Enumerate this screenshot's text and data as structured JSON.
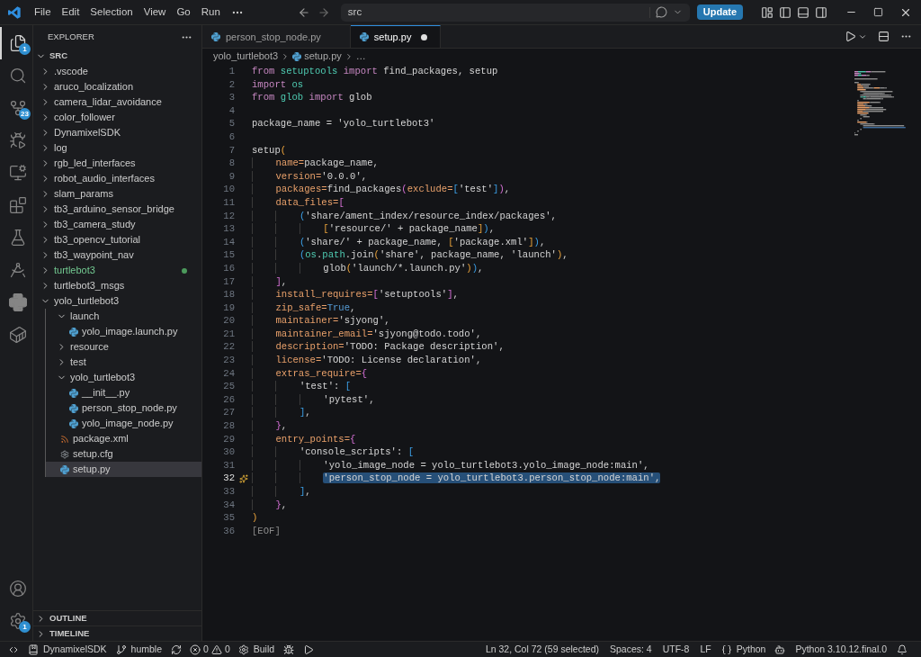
{
  "title_bar": {
    "menus": [
      "File",
      "Edit",
      "Selection",
      "View",
      "Go",
      "Run"
    ],
    "search": {
      "value": "src"
    },
    "update_button": "Update"
  },
  "activity_bar": {
    "top": [
      {
        "kind": "explorer",
        "selected": true,
        "badge": "1"
      },
      {
        "kind": "search",
        "selected": false
      },
      {
        "kind": "source-control",
        "selected": false,
        "badge": "23"
      },
      {
        "kind": "run-debug",
        "selected": false
      },
      {
        "kind": "remote",
        "selected": false
      },
      {
        "kind": "extensions",
        "selected": false
      },
      {
        "kind": "testing",
        "selected": false
      },
      {
        "kind": "compass",
        "selected": false
      },
      {
        "kind": "python",
        "selected": false
      },
      {
        "kind": "containers",
        "selected": false
      }
    ],
    "bottom": [
      {
        "kind": "account",
        "selected": false
      },
      {
        "kind": "settings",
        "selected": false,
        "badge": "1"
      }
    ]
  },
  "sidebar": {
    "title": "EXPLORER",
    "root": {
      "label": "SRC",
      "expanded": true
    },
    "tree": [
      {
        "label": ".vscode",
        "kind": "folder",
        "expanded": false,
        "selected": false,
        "git_changed": false
      },
      {
        "label": "aruco_localization",
        "kind": "folder",
        "expanded": false,
        "selected": false,
        "git_changed": false
      },
      {
        "label": "camera_lidar_avoidance",
        "kind": "folder",
        "expanded": false,
        "selected": false,
        "git_changed": false
      },
      {
        "label": "color_follower",
        "kind": "folder",
        "expanded": false,
        "selected": false,
        "git_changed": false
      },
      {
        "label": "DynamixelSDK",
        "kind": "folder",
        "expanded": false,
        "selected": false,
        "git_changed": false
      },
      {
        "label": "log",
        "kind": "folder",
        "expanded": false,
        "selected": false,
        "git_changed": false
      },
      {
        "label": "rgb_led_interfaces",
        "kind": "folder",
        "expanded": false,
        "selected": false,
        "git_changed": false
      },
      {
        "label": "robot_audio_interfaces",
        "kind": "folder",
        "expanded": false,
        "selected": false,
        "git_changed": false
      },
      {
        "label": "slam_params",
        "kind": "folder",
        "expanded": false,
        "selected": false,
        "git_changed": false
      },
      {
        "label": "tb3_arduino_sensor_bridge",
        "kind": "folder",
        "expanded": false,
        "selected": false,
        "git_changed": false
      },
      {
        "label": "tb3_camera_study",
        "kind": "folder",
        "expanded": false,
        "selected": false,
        "git_changed": false
      },
      {
        "label": "tb3_opencv_tutorial",
        "kind": "folder",
        "expanded": false,
        "selected": false,
        "git_changed": false
      },
      {
        "label": "tb3_waypoint_nav",
        "kind": "folder",
        "expanded": false,
        "selected": false,
        "git_changed": false
      },
      {
        "label": "turtlebot3",
        "kind": "folder",
        "expanded": false,
        "selected": false,
        "git_changed": true
      },
      {
        "label": "turtlebot3_msgs",
        "kind": "folder",
        "expanded": false,
        "selected": false,
        "git_changed": false
      },
      {
        "label": "yolo_turtlebot3",
        "kind": "folder",
        "expanded": true,
        "selected": false,
        "git_changed": false,
        "children": [
          {
            "label": "launch",
            "kind": "folder",
            "expanded": true,
            "selected": false,
            "git_changed": false,
            "children": [
              {
                "label": "yolo_image.launch.py",
                "kind": "python",
                "selected": false,
                "git_changed": false
              }
            ]
          },
          {
            "label": "resource",
            "kind": "folder",
            "expanded": false,
            "selected": false,
            "git_changed": false
          },
          {
            "label": "test",
            "kind": "folder",
            "expanded": false,
            "selected": false,
            "git_changed": false
          },
          {
            "label": "yolo_turtlebot3",
            "kind": "folder",
            "expanded": true,
            "selected": false,
            "git_changed": false,
            "children": [
              {
                "label": "__init__.py",
                "kind": "python",
                "selected": false,
                "git_changed": false
              },
              {
                "label": "person_stop_node.py",
                "kind": "python",
                "selected": false,
                "git_changed": false
              },
              {
                "label": "yolo_image_node.py",
                "kind": "python",
                "selected": false,
                "git_changed": false
              }
            ]
          },
          {
            "label": "package.xml",
            "kind": "xml",
            "selected": false,
            "git_changed": false
          },
          {
            "label": "setup.cfg",
            "kind": "config",
            "selected": false,
            "git_changed": false
          },
          {
            "label": "setup.py",
            "kind": "python",
            "selected": true,
            "git_changed": false
          }
        ]
      }
    ],
    "panels": [
      {
        "label": "OUTLINE",
        "expanded": false
      },
      {
        "label": "TIMELINE",
        "expanded": false
      }
    ]
  },
  "editor": {
    "tabs": [
      {
        "label": "person_stop_node.py",
        "selected": false,
        "dirty": false
      },
      {
        "label": "setup.py",
        "selected": true,
        "dirty": true
      }
    ],
    "breadcrumb": [
      "yolo_turtlebot3",
      "setup.py",
      "…"
    ],
    "lines": [
      {
        "number": "1",
        "current": false,
        "tokens": [
          {
            "kind": "kw",
            "text": "from "
          },
          {
            "kind": "mod",
            "text": "setuptools "
          },
          {
            "kind": "kw",
            "text": "import "
          },
          {
            "kind": "plain",
            "text": "find_packages, setup"
          }
        ]
      },
      {
        "number": "2",
        "current": false,
        "tokens": [
          {
            "kind": "kw",
            "text": "import "
          },
          {
            "kind": "mod",
            "text": "os"
          }
        ]
      },
      {
        "number": "3",
        "current": false,
        "tokens": [
          {
            "kind": "kw",
            "text": "from "
          },
          {
            "kind": "mod",
            "text": "glob "
          },
          {
            "kind": "kw",
            "text": "import "
          },
          {
            "kind": "plain",
            "text": "glob"
          }
        ]
      },
      {
        "number": "4",
        "current": false
      },
      {
        "number": "5",
        "current": false,
        "tokens": [
          {
            "kind": "plain",
            "text": "package_name = 'yolo_turtlebot3'"
          }
        ]
      },
      {
        "number": "6",
        "current": false
      },
      {
        "number": "7",
        "current": false,
        "tokens": [
          {
            "kind": "plain",
            "text": "setup"
          },
          {
            "kind": "b1",
            "text": "("
          }
        ]
      },
      {
        "number": "8",
        "current": false,
        "tokens": [
          {
            "kind": "param",
            "text": "    name="
          },
          {
            "kind": "plain",
            "text": "package_name,"
          }
        ]
      },
      {
        "number": "9",
        "current": false,
        "tokens": [
          {
            "kind": "param",
            "text": "    version="
          },
          {
            "kind": "plain",
            "text": "'0.0.0',"
          }
        ]
      },
      {
        "number": "10",
        "current": false,
        "tokens": [
          {
            "kind": "param",
            "text": "    packages="
          },
          {
            "kind": "plain",
            "text": "find_packages"
          },
          {
            "kind": "b2",
            "text": "("
          },
          {
            "kind": "param",
            "text": "exclude="
          },
          {
            "kind": "b3",
            "text": "["
          },
          {
            "kind": "plain",
            "text": "'test'"
          },
          {
            "kind": "b3",
            "text": "]"
          },
          {
            "kind": "b2",
            "text": ")"
          },
          {
            "kind": "plain",
            "text": ","
          }
        ]
      },
      {
        "number": "11",
        "current": false,
        "tokens": [
          {
            "kind": "param",
            "text": "    data_files="
          },
          {
            "kind": "b2",
            "text": "["
          }
        ]
      },
      {
        "number": "12",
        "current": false,
        "tokens": [
          {
            "kind": "b3",
            "text": "        ("
          },
          {
            "kind": "plain",
            "text": "'share/ament_index/resource_index/packages',"
          }
        ]
      },
      {
        "number": "13",
        "current": false,
        "tokens": [
          {
            "kind": "b1",
            "text": "            ["
          },
          {
            "kind": "plain",
            "text": "'resource/' + package_name"
          },
          {
            "kind": "b1",
            "text": "]"
          },
          {
            "kind": "b3",
            "text": ")"
          },
          {
            "kind": "plain",
            "text": ","
          }
        ]
      },
      {
        "number": "14",
        "current": false,
        "tokens": [
          {
            "kind": "b3",
            "text": "        ("
          },
          {
            "kind": "plain",
            "text": "'share/' + package_name, "
          },
          {
            "kind": "b1",
            "text": "["
          },
          {
            "kind": "plain",
            "text": "'package.xml'"
          },
          {
            "kind": "b1",
            "text": "]"
          },
          {
            "kind": "b3",
            "text": ")"
          },
          {
            "kind": "plain",
            "text": ","
          }
        ]
      },
      {
        "number": "15",
        "current": false,
        "tokens": [
          {
            "kind": "b3",
            "text": "        ("
          },
          {
            "kind": "mod",
            "text": "os"
          },
          {
            "kind": "plain",
            "text": "."
          },
          {
            "kind": "mod",
            "text": "path"
          },
          {
            "kind": "plain",
            "text": ".join"
          },
          {
            "kind": "b1",
            "text": "("
          },
          {
            "kind": "plain",
            "text": "'share', package_name, 'launch'"
          },
          {
            "kind": "b1",
            "text": ")"
          },
          {
            "kind": "plain",
            "text": ","
          }
        ]
      },
      {
        "number": "16",
        "current": false,
        "tokens": [
          {
            "kind": "plain",
            "text": "            glob"
          },
          {
            "kind": "b1",
            "text": "("
          },
          {
            "kind": "plain",
            "text": "'launch/*.launch.py'"
          },
          {
            "kind": "b1",
            "text": ")"
          },
          {
            "kind": "b3",
            "text": ")"
          },
          {
            "kind": "plain",
            "text": ","
          }
        ]
      },
      {
        "number": "17",
        "current": false,
        "tokens": [
          {
            "kind": "b2",
            "text": "    ]"
          },
          {
            "kind": "plain",
            "text": ","
          }
        ]
      },
      {
        "number": "18",
        "current": false,
        "tokens": [
          {
            "kind": "param",
            "text": "    install_requires="
          },
          {
            "kind": "b2",
            "text": "["
          },
          {
            "kind": "plain",
            "text": "'setuptools'"
          },
          {
            "kind": "b2",
            "text": "]"
          },
          {
            "kind": "plain",
            "text": ","
          }
        ]
      },
      {
        "number": "19",
        "current": false,
        "tokens": [
          {
            "kind": "param",
            "text": "    zip_safe="
          },
          {
            "kind": "const",
            "text": "True"
          },
          {
            "kind": "plain",
            "text": ","
          }
        ]
      },
      {
        "number": "20",
        "current": false,
        "tokens": [
          {
            "kind": "param",
            "text": "    maintainer="
          },
          {
            "kind": "plain",
            "text": "'sjyong',"
          }
        ]
      },
      {
        "number": "21",
        "current": false,
        "tokens": [
          {
            "kind": "param",
            "text": "    maintainer_email="
          },
          {
            "kind": "plain",
            "text": "'sjyong@todo.todo',"
          }
        ]
      },
      {
        "number": "22",
        "current": false,
        "tokens": [
          {
            "kind": "param",
            "text": "    description="
          },
          {
            "kind": "plain",
            "text": "'TODO: Package description',"
          }
        ]
      },
      {
        "number": "23",
        "current": false,
        "tokens": [
          {
            "kind": "param",
            "text": "    license="
          },
          {
            "kind": "plain",
            "text": "'TODO: License declaration',"
          }
        ]
      },
      {
        "number": "24",
        "current": false,
        "tokens": [
          {
            "kind": "param",
            "text": "    extras_require="
          },
          {
            "kind": "b2",
            "text": "{"
          }
        ]
      },
      {
        "number": "25",
        "current": false,
        "tokens": [
          {
            "kind": "plain",
            "text": "        'test': "
          },
          {
            "kind": "b3",
            "text": "["
          }
        ]
      },
      {
        "number": "26",
        "current": false,
        "tokens": [
          {
            "kind": "plain",
            "text": "            'pytest',"
          }
        ]
      },
      {
        "number": "27",
        "current": false,
        "tokens": [
          {
            "kind": "b3",
            "text": "        ]"
          },
          {
            "kind": "plain",
            "text": ","
          }
        ]
      },
      {
        "number": "28",
        "current": false,
        "tokens": [
          {
            "kind": "b2",
            "text": "    }"
          },
          {
            "kind": "plain",
            "text": ","
          }
        ]
      },
      {
        "number": "29",
        "current": false,
        "tokens": [
          {
            "kind": "param",
            "text": "    entry_points="
          },
          {
            "kind": "b2",
            "text": "{"
          }
        ]
      },
      {
        "number": "30",
        "current": false,
        "tokens": [
          {
            "kind": "plain",
            "text": "        'console_scripts': "
          },
          {
            "kind": "b3",
            "text": "["
          }
        ]
      },
      {
        "number": "31",
        "current": false,
        "tokens": [
          {
            "kind": "plain",
            "text": "            'yolo_image_node = yolo_turtlebot3.yolo_image_node:main',"
          }
        ]
      },
      {
        "number": "32",
        "current": true,
        "tokens": [
          {
            "kind": "selected",
            "text": "            'person_stop_node = yolo_turtlebot3.person_stop_node:main',"
          }
        ]
      },
      {
        "number": "33",
        "current": false,
        "tokens": [
          {
            "kind": "b3",
            "text": "        ]"
          },
          {
            "kind": "plain",
            "text": ","
          }
        ]
      },
      {
        "number": "34",
        "current": false,
        "tokens": [
          {
            "kind": "b2",
            "text": "    }"
          },
          {
            "kind": "plain",
            "text": ","
          }
        ]
      },
      {
        "number": "35",
        "current": false,
        "tokens": [
          {
            "kind": "b1",
            "text": ")"
          }
        ]
      },
      {
        "number": "36",
        "current": false,
        "tokens": [
          {
            "kind": "eof",
            "text": "[EOF]"
          }
        ]
      }
    ]
  },
  "status_bar": {
    "left": [
      {
        "kind": "remote"
      },
      {
        "kind": "repo",
        "text": "DynamixelSDK"
      },
      {
        "kind": "branch",
        "text": "humble"
      },
      {
        "kind": "sync"
      },
      {
        "kind": "problems",
        "errors": "0",
        "warnings": "0"
      },
      {
        "kind": "build",
        "text": "Build"
      },
      {
        "kind": "debug"
      },
      {
        "kind": "run"
      }
    ],
    "right": [
      {
        "kind": "text",
        "text": "Ln 32, Col 72 (59 selected)"
      },
      {
        "kind": "text",
        "text": "Spaces: 4"
      },
      {
        "kind": "text",
        "text": "UTF-8"
      },
      {
        "kind": "text",
        "text": "LF"
      },
      {
        "kind": "language",
        "text": "Python"
      },
      {
        "kind": "copilot"
      },
      {
        "kind": "text",
        "text": "Python 3.10.12.final.0"
      },
      {
        "kind": "bell"
      }
    ]
  }
}
